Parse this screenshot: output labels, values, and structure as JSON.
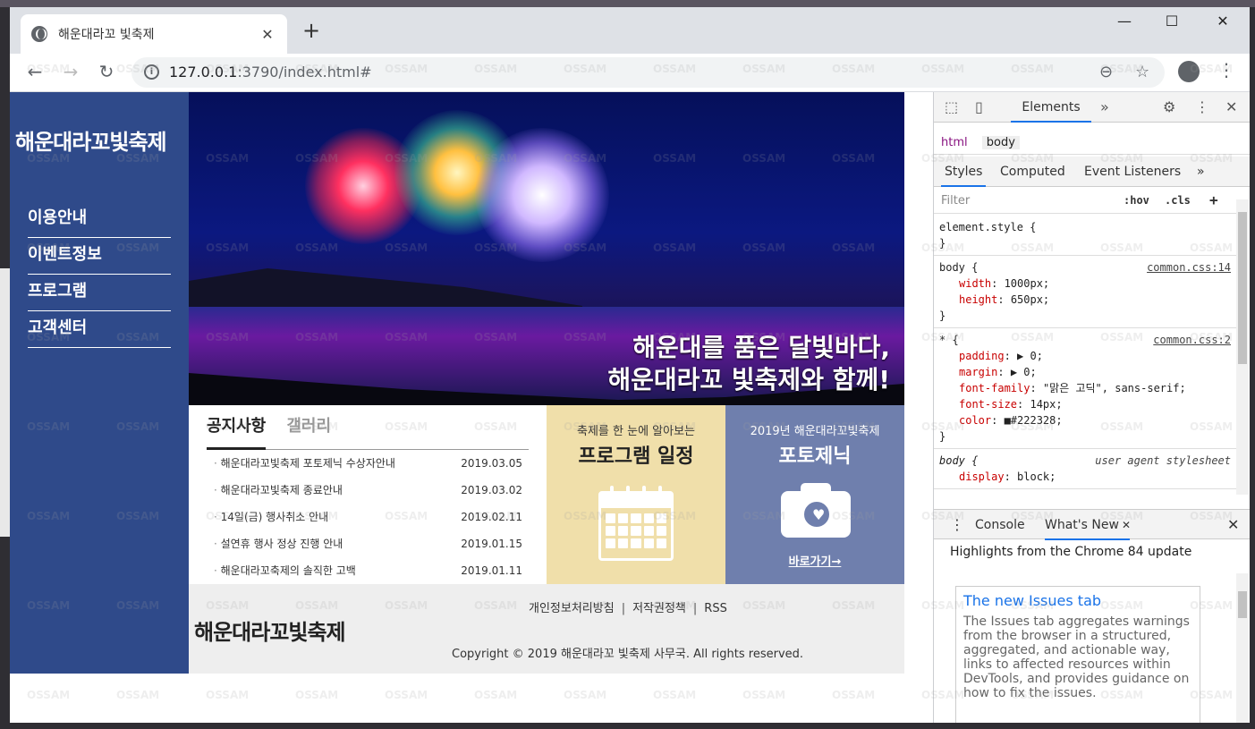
{
  "browser": {
    "tab_title": "해운대라꼬 빛축제",
    "url_host": "127.0.0.1",
    "url_rest": ":3790/index.html#",
    "new_tab": "+",
    "tab_close": "✕",
    "minimize": "—",
    "maximize": "☐",
    "close": "✕",
    "back": "←",
    "forward": "→",
    "reload": "↻",
    "zoom_icon": "⊖",
    "star_icon": "☆",
    "menu": "⋮"
  },
  "site": {
    "logo": "해운대라꼬빛축제",
    "nav": [
      "이용안내",
      "이벤트정보",
      "프로그램",
      "고객센터"
    ],
    "hero_line1": "해운대를 품은 달빛바다,",
    "hero_line2": "해운대라꼬 빛축제와 함께!",
    "notice_tab": "공지사항",
    "gallery_tab": "갤러리",
    "notices": [
      {
        "title": "해운대라꼬빛축제 포토제닉 수상자안내",
        "date": "2019.03.05"
      },
      {
        "title": "해운대라꼬빛축제 종료안내",
        "date": "2019.03.02"
      },
      {
        "title": "14일(금) 행사취소 안내",
        "date": "2019.02.11"
      },
      {
        "title": "설연휴 행사 정상 진행 안내",
        "date": "2019.01.15"
      },
      {
        "title": "해운대라꼬축제의 솔직한 고백",
        "date": "2019.01.11"
      }
    ],
    "program_sub": "축제를 한 눈에 알아보는",
    "program_title": "프로그램 일정",
    "photo_sub": "2019년 해운대라꼬빛축제",
    "photo_title": "포토제닉",
    "photo_link": "바로가기→",
    "footer_logo": "해운대라꼬빛축제",
    "footer_links": [
      "개인정보처리방침",
      "저작권정책",
      "RSS"
    ],
    "copyright": "Copyright © 2019 해운대라꼬 빛축제 사무국. All rights reserved."
  },
  "devtools": {
    "elements_tab": "Elements",
    "more": "»",
    "crumb_html": "html",
    "crumb_body": "body",
    "styles_tab": "Styles",
    "computed_tab": "Computed",
    "listeners_tab": "Event Listeners",
    "filter_placeholder": "Filter",
    "hov": ":hov",
    "cls": ".cls",
    "plus": "+",
    "rules": [
      {
        "selector": "element.style {",
        "source": "",
        "props": [],
        "close": "}"
      },
      {
        "selector": "body {",
        "source": "common.css:14",
        "props": [
          {
            "name": "width",
            "value": "1000px;"
          },
          {
            "name": "height",
            "value": "650px;"
          }
        ],
        "close": "}"
      },
      {
        "selector": "* {",
        "source": "common.css:2",
        "props": [
          {
            "name": "padding",
            "value": "▶ 0;"
          },
          {
            "name": "margin",
            "value": "▶ 0;"
          },
          {
            "name": "font-family",
            "value": "\"맑은 고딕\", sans-serif;"
          },
          {
            "name": "font-size",
            "value": "14px;"
          },
          {
            "name": "color",
            "value": "■#222328;"
          }
        ],
        "close": "}"
      },
      {
        "selector": "body {",
        "source": "user agent stylesheet",
        "props": [
          {
            "name": "display",
            "value": "block;"
          }
        ],
        "close": ""
      }
    ],
    "console_tab": "Console",
    "whatsnew_tab": "What's New",
    "highlights": "Highlights from the Chrome 84 update",
    "card_title": "The new Issues tab",
    "card_body": "The Issues tab aggregates warnings from the browser in a structured, aggregated, and actionable way, links to affected resources within DevTools, and provides guidance on how to fix the issues."
  },
  "watermark": "OSSAM"
}
